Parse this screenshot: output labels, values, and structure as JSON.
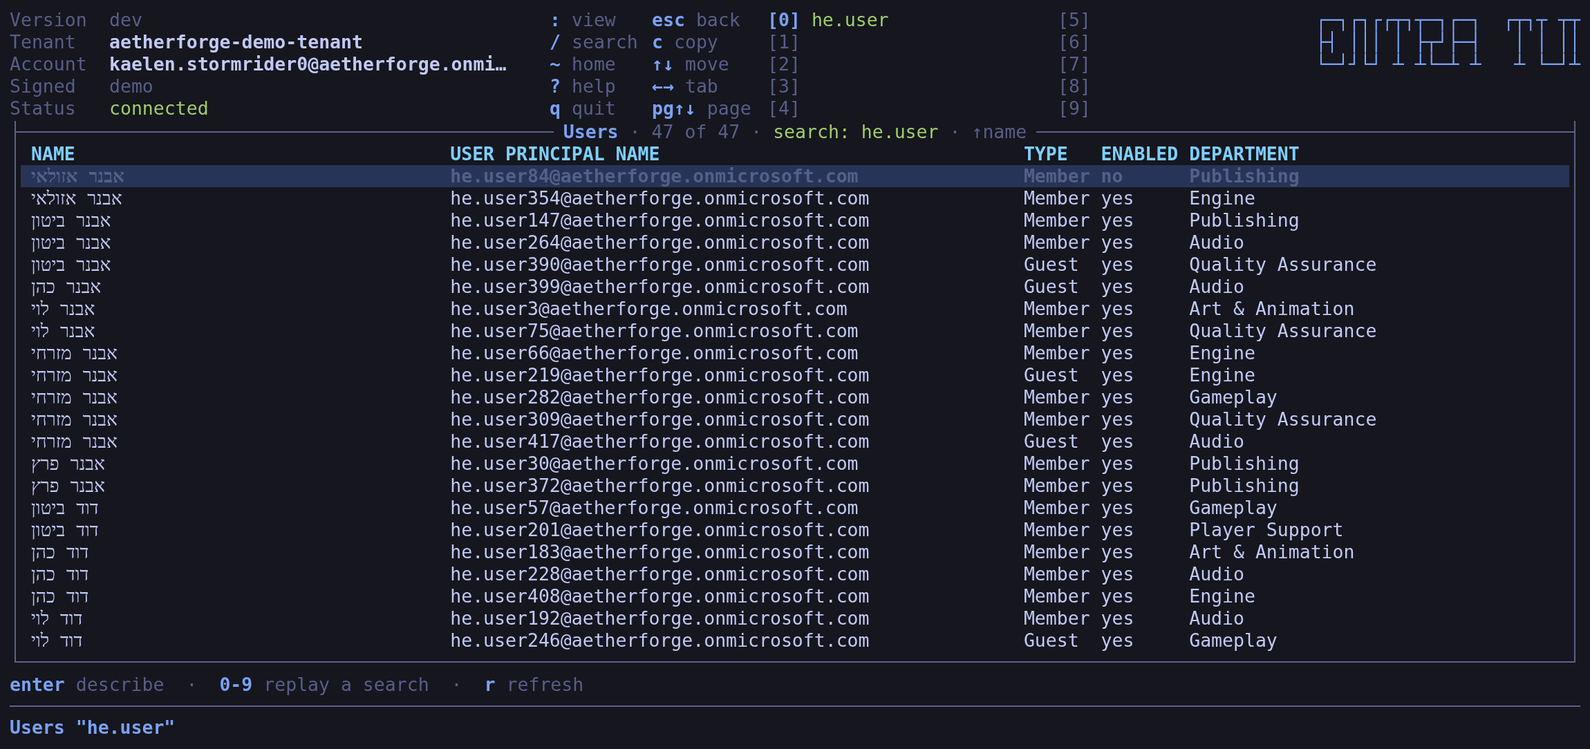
{
  "info": [
    {
      "label": "Version",
      "value": "dev",
      "kind": "dim"
    },
    {
      "label": "Tenant",
      "value": "aetherforge-demo-tenant",
      "kind": "bold"
    },
    {
      "label": "Account",
      "value": "kaelen.stormrider0@aetherforge.onmi…",
      "kind": "bold"
    },
    {
      "label": "Signed",
      "value": "demo",
      "kind": "dim"
    },
    {
      "label": "Status",
      "value": "connected",
      "kind": "ok"
    }
  ],
  "key_columns": [
    [
      {
        "key": ":",
        "label": "view"
      },
      {
        "key": "/",
        "label": "search"
      },
      {
        "key": "~",
        "label": "home"
      },
      {
        "key": "?",
        "label": "help"
      },
      {
        "key": "q",
        "label": "quit"
      }
    ],
    [
      {
        "key": "esc",
        "label": "back"
      },
      {
        "key": "c",
        "label": "copy"
      },
      {
        "key": "↑↓",
        "label": "move"
      },
      {
        "key": "←→",
        "label": "tab"
      },
      {
        "key": "pg↑↓",
        "label": "page"
      }
    ]
  ],
  "recent_searches": [
    {
      "index": "[0]",
      "query": "he.user"
    },
    {
      "index": "[1]"
    },
    {
      "index": "[2]"
    },
    {
      "index": "[3]"
    },
    {
      "index": "[4]"
    },
    {
      "index": "[5]"
    },
    {
      "index": "[6]"
    },
    {
      "index": "[7]"
    },
    {
      "index": "[8]"
    },
    {
      "index": "[9]"
    }
  ],
  "logo": {
    "lines": [
      "┌─┐┌┐┌┌┬┐┬─┐┌─┐  ┌┬┐┬ ┬┬",
      "├┤ │││ │ ├┬┘├─┤   │ │ ││",
      "└─┘┘└┘ ┴ ┴└─┴ ┴   ┴ └─┘┴"
    ]
  },
  "panel": {
    "title": [
      {
        "text": "Users",
        "kind": "name"
      },
      {
        "text": "·",
        "kind": "sep"
      },
      {
        "text": "47 of 47",
        "kind": "dim"
      },
      {
        "text": "·",
        "kind": "sep"
      },
      {
        "text": "search: he.user",
        "kind": "search"
      },
      {
        "text": "·",
        "kind": "sep"
      },
      {
        "text": "↑name",
        "kind": "dim"
      }
    ],
    "columns": [
      "NAME",
      "USER PRINCIPAL NAME",
      "TYPE",
      "ENABLED",
      "DEPARTMENT"
    ],
    "rows": [
      {
        "cells": [
          "אבנר אזולאי",
          "he.user84@aetherforge.onmicrosoft.com",
          "Member",
          "no",
          "Publishing"
        ],
        "selected": true
      },
      {
        "cells": [
          "אבנר אזולאי",
          "he.user354@aetherforge.onmicrosoft.com",
          "Member",
          "yes",
          "Engine"
        ],
        "selected": false
      },
      {
        "cells": [
          "אבנר ביטון",
          "he.user147@aetherforge.onmicrosoft.com",
          "Member",
          "yes",
          "Publishing"
        ],
        "selected": false
      },
      {
        "cells": [
          "אבנר ביטון",
          "he.user264@aetherforge.onmicrosoft.com",
          "Member",
          "yes",
          "Audio"
        ],
        "selected": false
      },
      {
        "cells": [
          "אבנר ביטון",
          "he.user390@aetherforge.onmicrosoft.com",
          "Guest",
          "yes",
          "Quality Assurance"
        ],
        "selected": false
      },
      {
        "cells": [
          "אבנר כהן",
          "he.user399@aetherforge.onmicrosoft.com",
          "Guest",
          "yes",
          "Audio"
        ],
        "selected": false
      },
      {
        "cells": [
          "אבנר לוי",
          "he.user3@aetherforge.onmicrosoft.com",
          "Member",
          "yes",
          "Art & Animation"
        ],
        "selected": false
      },
      {
        "cells": [
          "אבנר לוי",
          "he.user75@aetherforge.onmicrosoft.com",
          "Member",
          "yes",
          "Quality Assurance"
        ],
        "selected": false
      },
      {
        "cells": [
          "אבנר מזרחי",
          "he.user66@aetherforge.onmicrosoft.com",
          "Member",
          "yes",
          "Engine"
        ],
        "selected": false
      },
      {
        "cells": [
          "אבנר מזרחי",
          "he.user219@aetherforge.onmicrosoft.com",
          "Guest",
          "yes",
          "Engine"
        ],
        "selected": false
      },
      {
        "cells": [
          "אבנר מזרחי",
          "he.user282@aetherforge.onmicrosoft.com",
          "Member",
          "yes",
          "Gameplay"
        ],
        "selected": false
      },
      {
        "cells": [
          "אבנר מזרחי",
          "he.user309@aetherforge.onmicrosoft.com",
          "Member",
          "yes",
          "Quality Assurance"
        ],
        "selected": false
      },
      {
        "cells": [
          "אבנר מזרחי",
          "he.user417@aetherforge.onmicrosoft.com",
          "Guest",
          "yes",
          "Audio"
        ],
        "selected": false
      },
      {
        "cells": [
          "אבנר פרץ",
          "he.user30@aetherforge.onmicrosoft.com",
          "Member",
          "yes",
          "Publishing"
        ],
        "selected": false
      },
      {
        "cells": [
          "אבנר פרץ",
          "he.user372@aetherforge.onmicrosoft.com",
          "Member",
          "yes",
          "Publishing"
        ],
        "selected": false
      },
      {
        "cells": [
          "דוד ביטון",
          "he.user57@aetherforge.onmicrosoft.com",
          "Member",
          "yes",
          "Gameplay"
        ],
        "selected": false
      },
      {
        "cells": [
          "דוד ביטון",
          "he.user201@aetherforge.onmicrosoft.com",
          "Member",
          "yes",
          "Player Support"
        ],
        "selected": false
      },
      {
        "cells": [
          "דוד כהן",
          "he.user183@aetherforge.onmicrosoft.com",
          "Member",
          "yes",
          "Art & Animation"
        ],
        "selected": false
      },
      {
        "cells": [
          "דוד כהן",
          "he.user228@aetherforge.onmicrosoft.com",
          "Member",
          "yes",
          "Audio"
        ],
        "selected": false
      },
      {
        "cells": [
          "דוד כהן",
          "he.user408@aetherforge.onmicrosoft.com",
          "Member",
          "yes",
          "Engine"
        ],
        "selected": false
      },
      {
        "cells": [
          "דוד לוי",
          "he.user192@aetherforge.onmicrosoft.com",
          "Member",
          "yes",
          "Audio"
        ],
        "selected": false
      },
      {
        "cells": [
          "דוד לוי",
          "he.user246@aetherforge.onmicrosoft.com",
          "Guest",
          "yes",
          "Gameplay"
        ],
        "selected": false
      }
    ]
  },
  "footer": [
    {
      "text": "enter",
      "kind": "key"
    },
    {
      "text": "describe",
      "kind": "label"
    },
    {
      "text": "·",
      "kind": "sep"
    },
    {
      "text": "0-9",
      "kind": "key"
    },
    {
      "text": "replay a search",
      "kind": "label"
    },
    {
      "text": "·",
      "kind": "sep"
    },
    {
      "text": "r",
      "kind": "key"
    },
    {
      "text": "refresh",
      "kind": "label"
    }
  ],
  "command_line": "Users \"he.user\""
}
